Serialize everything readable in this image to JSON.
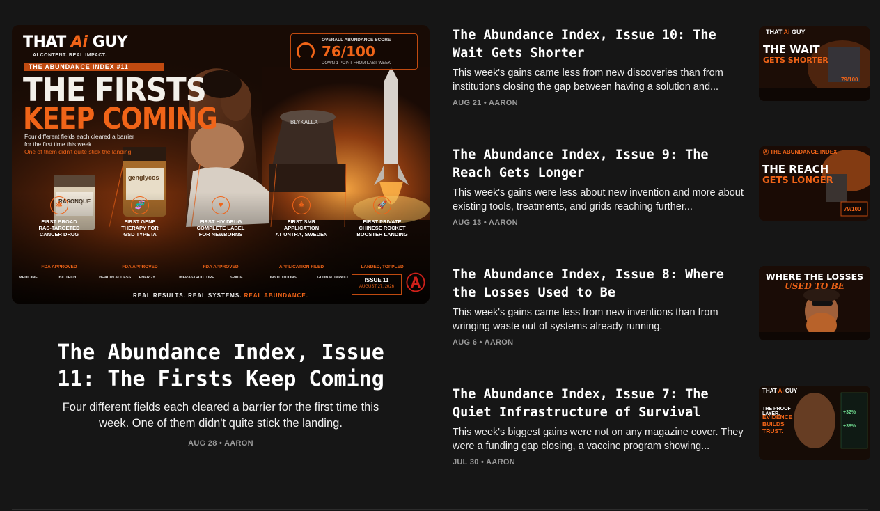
{
  "featured": {
    "title": "The Abundance Index, Issue 11: The Firsts Keep Coming",
    "subtitle": "Four different fields each cleared a barrier for the first time this week. One of them didn't quite stick the landing.",
    "meta": "AUG 28 • AARON",
    "image": {
      "brand_that": "THAT",
      "brand_ai": "Ai",
      "brand_guy": "GUY",
      "tagline": "AI CONTENT. REAL IMPACT.",
      "kicker": "THE ABUNDANCE INDEX #11",
      "headline_1": "THE FIRSTS",
      "headline_2": "KEEP COMING",
      "intro_1": "Four different fields each cleared a barrier",
      "intro_2": "for the first time this week.",
      "intro_3": "One of them didn't quite stick the landing.",
      "score_label": "OVERALL ABUNDANCE SCORE",
      "score": "76/100",
      "score_note": "DOWN 1 POINT FROM LAST WEEK",
      "panels": [
        {
          "title_1": "FIRST BROAD",
          "title_2": "RAS-TARGETED",
          "title_3": "CANCER DRUG",
          "status": "FDA APPROVED"
        },
        {
          "title_1": "FIRST GENE",
          "title_2": "THERAPY FOR",
          "title_3": "GSD TYPE IA",
          "status": "FDA APPROVED"
        },
        {
          "title_1": "FIRST HIV DRUG",
          "title_2": "COMPLETE LABEL",
          "title_3": "FOR NEWBORNS",
          "status": "FDA APPROVED"
        },
        {
          "title_1": "FIRST SMR",
          "title_2": "APPLICATION",
          "title_3": "AT UNTRA, SWEDEN",
          "status": "APPLICATION FILED"
        },
        {
          "title_1": "FIRST PRIVATE",
          "title_2": "CHINESE ROCKET",
          "title_3": "BOOSTER LANDING",
          "status": "LANDED, TOPPLED"
        }
      ],
      "categories": [
        "MEDICINE",
        "BIOTECH",
        "HEALTH ACCESS",
        "ENERGY",
        "INFRASTRUCTURE",
        "SPACE",
        "INSTITUTIONS",
        "GLOBAL IMPACT"
      ],
      "issue_label": "ISSUE 11",
      "issue_date": "AUGUST 27, 2026",
      "footer": "REAL RESULTS. REAL SYSTEMS.",
      "footer_accent": "REAL ABUNDANCE."
    }
  },
  "posts": [
    {
      "title": "The Abundance Index, Issue 10: The Wait Gets Shorter",
      "desc": "This week's gains came less from new discoveries than from institutions closing the gap between having a solution and...",
      "meta": "AUG 21 • AARON",
      "thumb": {
        "line1": "THE WAIT",
        "line2": "GETS SHORTER",
        "score": "79/100"
      }
    },
    {
      "title": "The Abundance Index, Issue 9: The Reach Gets Longer",
      "desc": "This week's gains were less about new invention and more about existing tools, treatments, and grids reaching further...",
      "meta": "AUG 13 • AARON",
      "thumb": {
        "line1": "THE REACH",
        "line2": "GETS LONGER",
        "score": "79/100"
      }
    },
    {
      "title": "The Abundance Index, Issue 8: Where the Losses Used to Be",
      "desc": "This week's gains came less from new inventions than from wringing waste out of systems already running.",
      "meta": "AUG 6 • AARON",
      "thumb": {
        "line1": "WHERE THE LOSSES",
        "line2": "USED TO BE",
        "score": ""
      }
    },
    {
      "title": "The Abundance Index, Issue 7: The Quiet Infrastructure of Survival",
      "desc": "This week's biggest gains were not on any magazine cover. They were a funding gap closing, a vaccine program showing...",
      "meta": "JUL 30 • AARON",
      "thumb": {
        "line1": "THE PROOF LAYER.",
        "line2": "EVIDENCE BUILDS TRUST.",
        "score": ""
      }
    }
  ],
  "colors": {
    "accent": "#f06418",
    "bg": "#161616",
    "meta": "#9a9a9a"
  }
}
